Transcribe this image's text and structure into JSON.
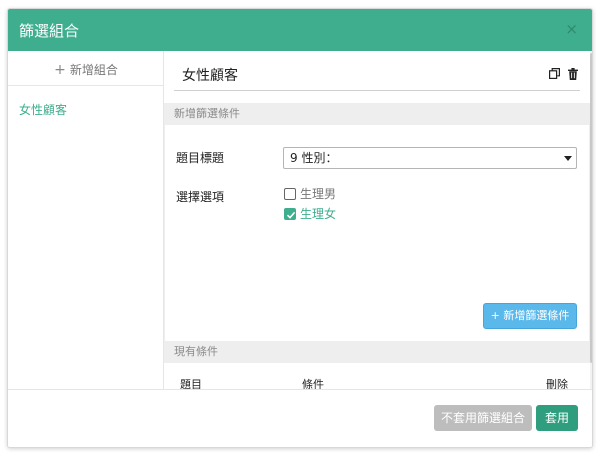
{
  "modal": {
    "title": "篩選組合",
    "close_icon": "×"
  },
  "sidebar": {
    "add_label": "新增組合",
    "add_icon": "+",
    "items": [
      {
        "label": "女性顧客"
      }
    ]
  },
  "group": {
    "name": "女性顧客"
  },
  "new_condition": {
    "section_title": "新增篩選條件",
    "question_label": "題目標題",
    "question_selected": "9 性別：",
    "options_label": "選擇選項",
    "options": [
      {
        "label": "生理男",
        "checked": false
      },
      {
        "label": "生理女",
        "checked": true
      }
    ],
    "add_button": "+ 新增篩選條件"
  },
  "existing_conditions": {
    "section_title": "現有條件",
    "columns": [
      "題目",
      "條件",
      "刪除"
    ]
  },
  "footer": {
    "disable_button": "不套用篩選組合",
    "apply_button": "套用"
  },
  "colors": {
    "header": "#3eae8e",
    "accent": "#3eae8e",
    "info_button": "#5bb8ea",
    "disabled_button": "#bdbdbd",
    "apply_button": "#2e9e7e"
  },
  "icons": [
    "copy-icon",
    "trash-icon",
    "close-icon",
    "plus-icon",
    "checkbox-icon",
    "chevron-down-icon"
  ]
}
